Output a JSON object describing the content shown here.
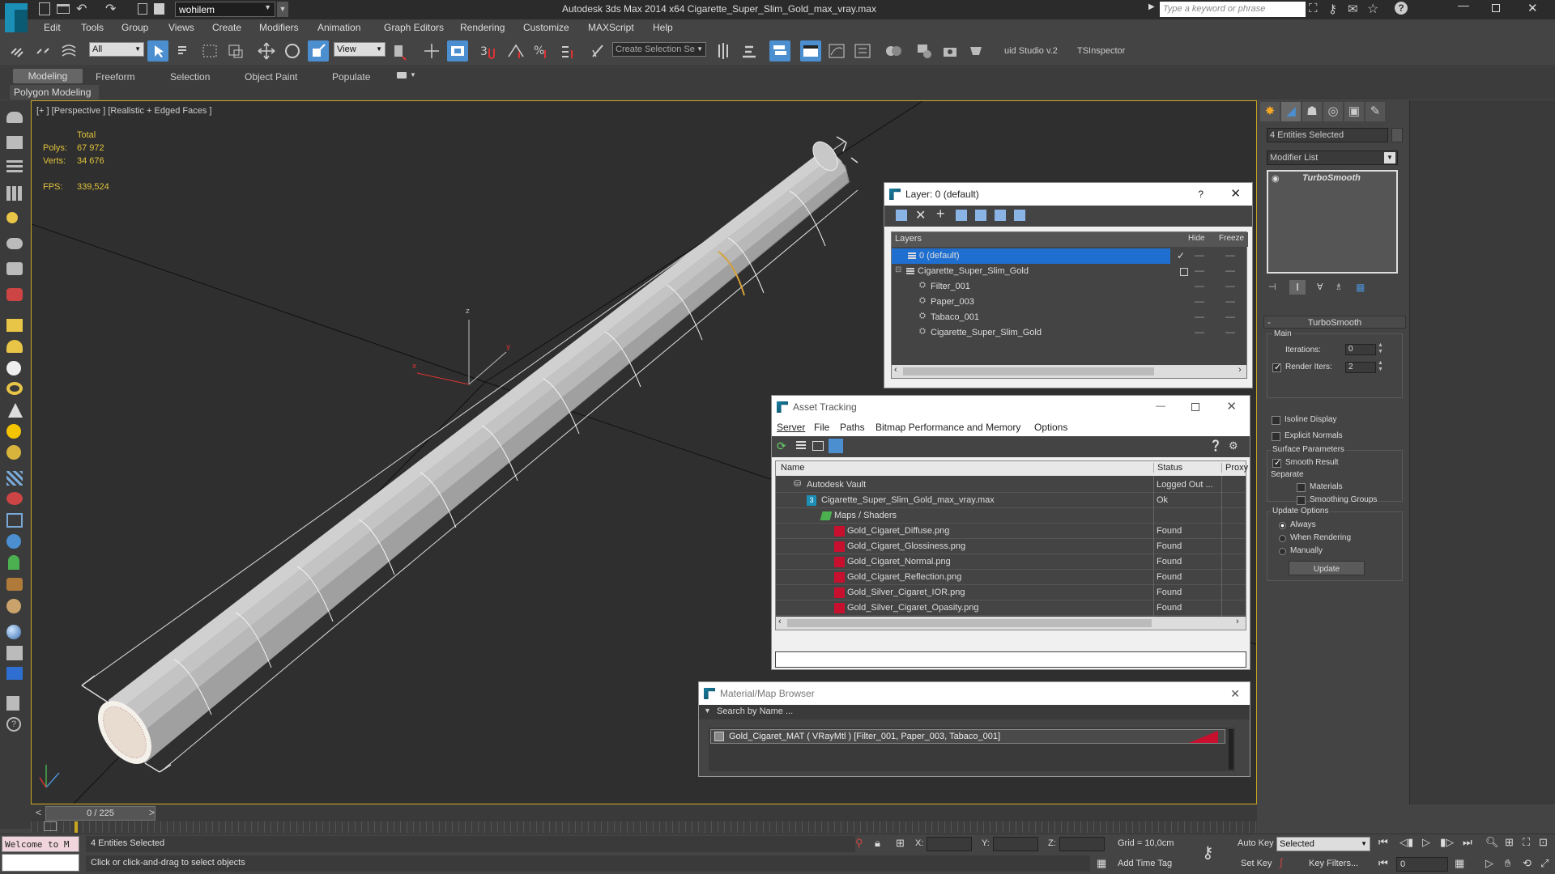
{
  "titlebar": {
    "workspace": "wohilem",
    "title": "Autodesk 3ds Max  2014 x64    Cigarette_Super_Slim_Gold_max_vray.max",
    "search_placeholder": "Type a keyword or phrase"
  },
  "menu": [
    "Edit",
    "Tools",
    "Group",
    "Views",
    "Create",
    "Modifiers",
    "Animation",
    "Graph Editors",
    "Rendering",
    "Customize",
    "MAXScript",
    "Help"
  ],
  "toolbar": {
    "filter": "All",
    "refcoord": "View",
    "selection_set": "Create Selection Se",
    "plugin1": "uid Studio v.2",
    "plugin2": "TSInspector"
  },
  "ribbon_tabs": [
    "Modeling",
    "Freeform",
    "Selection",
    "Object Paint",
    "Populate"
  ],
  "ribbon_sub": "Polygon Modeling",
  "viewport": {
    "label": "[+ ] [Perspective ] [Realistic + Edged Faces ]",
    "stats_total": "Total",
    "polys_label": "Polys:",
    "polys": "67 972",
    "verts_label": "Verts:",
    "verts": "34 676",
    "fps_label": "FPS:",
    "fps": "339,524"
  },
  "command_panel": {
    "selected": "4 Entities Selected",
    "modifier_list": "Modifier List",
    "stack_item": "TurboSmooth",
    "rollout": "TurboSmooth",
    "main": "Main",
    "iterations_label": "Iterations:",
    "iterations": "0",
    "render_iters_label": "Render Iters:",
    "render_iters": "2",
    "isoline": "Isoline Display",
    "explicit_normals": "Explicit Normals",
    "surface_params": "Surface Parameters",
    "smooth_result": "Smooth Result",
    "separate": "Separate",
    "materials": "Materials",
    "smoothing_groups": "Smoothing Groups",
    "update_options": "Update Options",
    "always": "Always",
    "when_rendering": "When Rendering",
    "manually": "Manually",
    "update_btn": "Update"
  },
  "layer_dialog": {
    "title": "Layer: 0 (default)",
    "help": "?",
    "col_layers": "Layers",
    "col_hide": "Hide",
    "col_freeze": "Freeze",
    "rows": [
      {
        "name": "0 (default)",
        "indent": 1
      },
      {
        "name": "Cigarette_Super_Slim_Gold",
        "indent": 1
      },
      {
        "name": "Filter_001",
        "indent": 2
      },
      {
        "name": "Paper_003",
        "indent": 2
      },
      {
        "name": "Tabaco_001",
        "indent": 2
      },
      {
        "name": "Cigarette_Super_Slim_Gold",
        "indent": 2
      }
    ]
  },
  "asset_tracking": {
    "title": "Asset Tracking",
    "menu": [
      "Server",
      "File",
      "Paths",
      "Bitmap Performance and Memory",
      "Options"
    ],
    "col_name": "Name",
    "col_status": "Status",
    "col_proxy": "Proxy",
    "rows": [
      {
        "name": "Autodesk Vault",
        "status": "Logged Out ...",
        "indent": 1
      },
      {
        "name": "Cigarette_Super_Slim_Gold_max_vray.max",
        "status": "Ok",
        "indent": 2
      },
      {
        "name": "Maps / Shaders",
        "status": "",
        "indent": 3
      },
      {
        "name": "Gold_Cigaret_Diffuse.png",
        "status": "Found",
        "indent": 4
      },
      {
        "name": "Gold_Cigaret_Glossiness.png",
        "status": "Found",
        "indent": 4
      },
      {
        "name": "Gold_Cigaret_Normal.png",
        "status": "Found",
        "indent": 4
      },
      {
        "name": "Gold_Cigaret_Reflection.png",
        "status": "Found",
        "indent": 4
      },
      {
        "name": "Gold_Silver_Cigaret_IOR.png",
        "status": "Found",
        "indent": 4
      },
      {
        "name": "Gold_Silver_Cigaret_Opasity.png",
        "status": "Found",
        "indent": 4
      }
    ]
  },
  "material_browser": {
    "title": "Material/Map Browser",
    "search_placeholder": "Search by Name ...",
    "item": "Gold_Cigaret_MAT  ( VRayMtl )  [Filter_001, Paper_003, Tabaco_001]"
  },
  "timeline": {
    "frame": "0 / 225"
  },
  "statusbar": {
    "listener": "Welcome to M",
    "selected": "4 Entities Selected",
    "prompt": "Click or click-and-drag to select objects",
    "x_label": "X:",
    "y_label": "Y:",
    "z_label": "Z:",
    "grid": "Grid = 10,0cm",
    "add_time_tag": "Add Time Tag",
    "auto_key": "Auto Key",
    "set_key": "Set Key",
    "key_mode": "Selected",
    "key_filters": "Key Filters...",
    "frame_field": "0"
  },
  "colors": {
    "accent_blue": "#3a8fd8",
    "viewport_bg": "#2f2f2f",
    "selection_highlight": "#1f6fd1",
    "asset_missing_red": "#c8102e"
  }
}
